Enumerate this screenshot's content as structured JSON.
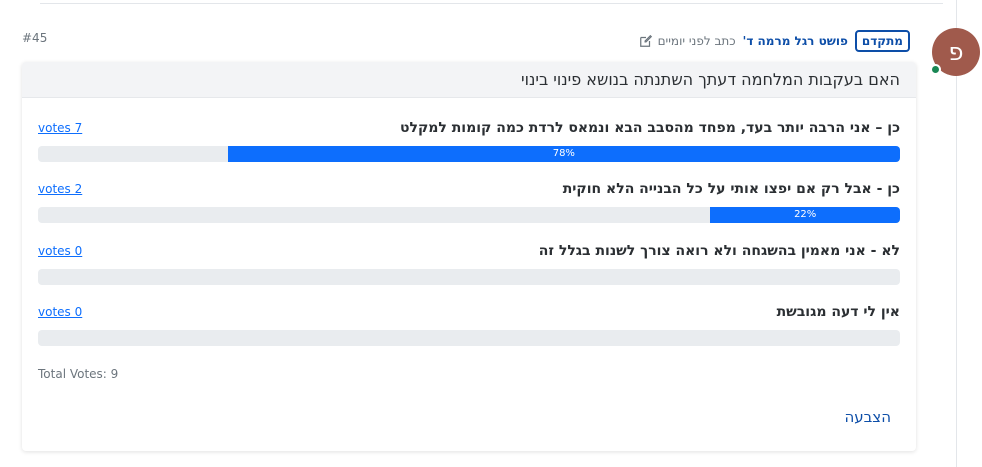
{
  "post": {
    "number": "#45",
    "avatar_letter": "פ",
    "badge": "מתקדם",
    "author": "פושט רגל מרמה ד'",
    "time": "כתב לפני יומיים"
  },
  "poll": {
    "question": "האם בעקבות המלחמה דעתך השתנתה בנושא פינוי בינוי",
    "options": [
      {
        "label": "כן – אני הרבה יותר בעד, מפחד מהסבב הבא ונמאס לרדת כמה קומות למקלט",
        "votes_text": "votes 7",
        "percent": 78,
        "percent_label": "78%"
      },
      {
        "label": "כן - אבל רק אם יפצו אותי על כל הבנייה הלא חוקית",
        "votes_text": "votes 2",
        "percent": 22,
        "percent_label": "22%"
      },
      {
        "label": "לא - אני מאמין בהשגחה ולא רואה צורך לשנות בגלל זה",
        "votes_text": "votes 0",
        "percent": 0,
        "percent_label": ""
      },
      {
        "label": "אין לי דעה מגובשת",
        "votes_text": "votes 0",
        "percent": 0,
        "percent_label": ""
      }
    ],
    "total": "Total Votes: 9",
    "vote_button": "הצבעה"
  },
  "colors": {
    "accent": "#0d6efd",
    "link_dark": "#0d4ea8",
    "avatar_bg": "#a05a4c",
    "online": "#198754",
    "track": "#e9ecef"
  },
  "icons": {
    "edit": "edit-icon"
  }
}
